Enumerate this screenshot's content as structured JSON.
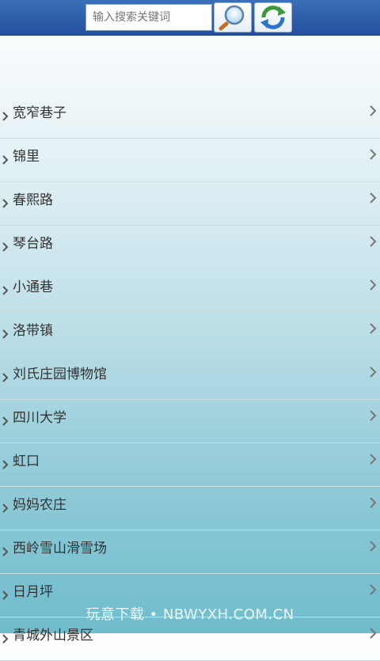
{
  "search": {
    "placeholder": "输入搜索关键词"
  },
  "list": {
    "items": [
      {
        "label": "宽窄巷子"
      },
      {
        "label": "锦里"
      },
      {
        "label": "春熙路"
      },
      {
        "label": "琴台路"
      },
      {
        "label": "小通巷"
      },
      {
        "label": "洛带镇"
      },
      {
        "label": "刘氏庄园博物馆"
      },
      {
        "label": "四川大学"
      },
      {
        "label": "虹口"
      },
      {
        "label": "妈妈农庄"
      },
      {
        "label": "西岭雪山滑雪场"
      },
      {
        "label": "日月坪"
      },
      {
        "label": "青城外山景区"
      }
    ]
  },
  "watermark": {
    "text": "玩意下载 • NBWYXH.COM.CN"
  },
  "colors": {
    "topbar": "#2d5ea8",
    "list_text": "#333333",
    "divider": "#c9dde3"
  },
  "icons": {
    "search_button": "magnifier-icon",
    "refresh_button": "refresh-icon",
    "list_arrow": "chevron-right-icon"
  }
}
